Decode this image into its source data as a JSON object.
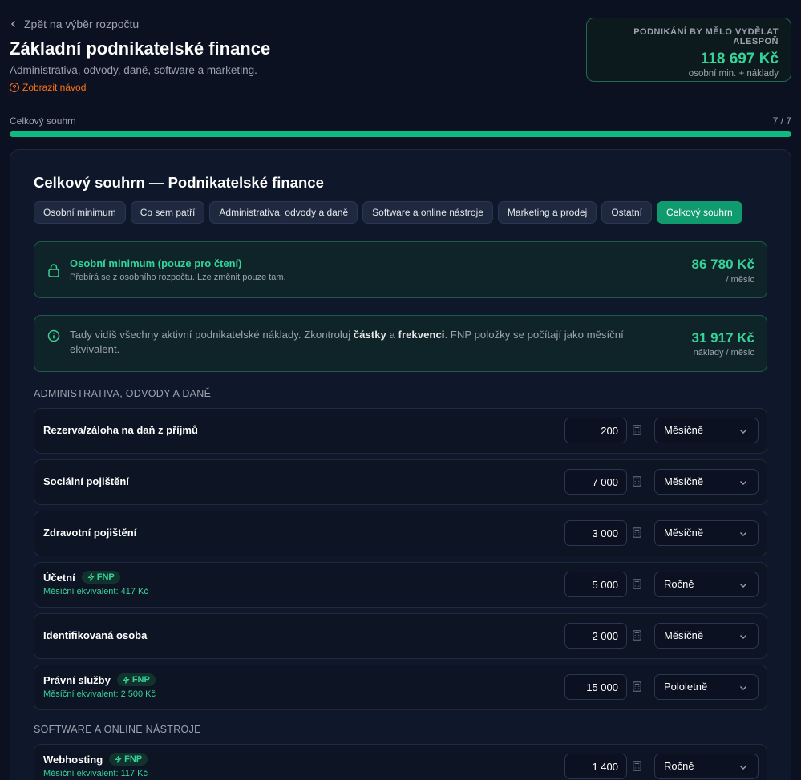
{
  "header": {
    "back_label": "Zpět na výběr rozpočtu",
    "title": "Základní podnikatelské finance",
    "subtitle": "Administrativa, odvody, daně, software a marketing.",
    "guide_label": "Zobrazit návod"
  },
  "earn_card": {
    "label": "PODNIKÁNÍ BY MĚLO VYDĚLAT ALESPOŇ",
    "value": "118 697 Kč",
    "sub": "osobní min. + náklady"
  },
  "progress": {
    "label": "Celkový souhrn",
    "count": "7 / 7",
    "fraction": 1.0
  },
  "section": {
    "title": "Celkový souhrn — Podnikatelské finance"
  },
  "tabs": [
    {
      "label": "Osobní minimum",
      "active": false
    },
    {
      "label": "Co sem patří",
      "active": false
    },
    {
      "label": "Administrativa, odvody a daně",
      "active": false
    },
    {
      "label": "Software a online nástroje",
      "active": false
    },
    {
      "label": "Marketing a prodej",
      "active": false
    },
    {
      "label": "Ostatní",
      "active": false
    },
    {
      "label": "Celkový souhrn",
      "active": true
    }
  ],
  "personal_min": {
    "title": "Osobní minimum (pouze pro čtení)",
    "desc": "Přebírá se z osobního rozpočtu. Lze změnit pouze tam.",
    "amount": "86 780 Kč",
    "unit": "/ měsíc"
  },
  "summary": {
    "text_1": "Tady vidíš všechny aktivní podnikatelské náklady. Zkontroluj ",
    "bold_1": "částky",
    "text_2": " a ",
    "bold_2": "frekvenci",
    "text_3": ". FNP položky se počítají jako měsíční ekvivalent.",
    "amount": "31 917 Kč",
    "unit": "náklady / měsíc"
  },
  "groups": [
    {
      "heading": "ADMINISTRATIVA, ODVODY A DANĚ",
      "rows": [
        {
          "name": "Rezerva/záloha na daň z příjmů",
          "amount": "200",
          "frequency": "Měsíčně",
          "fnp": "",
          "equiv": ""
        },
        {
          "name": "Sociální pojištění",
          "amount": "7 000",
          "frequency": "Měsíčně",
          "fnp": "",
          "equiv": ""
        },
        {
          "name": "Zdravotní pojištění",
          "amount": "3 000",
          "frequency": "Měsíčně",
          "fnp": "",
          "equiv": ""
        },
        {
          "name": "Účetní",
          "amount": "5 000",
          "frequency": "Ročně",
          "fnp": "FNP",
          "equiv": "Měsíční ekvivalent: 417 Kč"
        },
        {
          "name": "Identifikovaná osoba",
          "amount": "2 000",
          "frequency": "Měsíčně",
          "fnp": "",
          "equiv": ""
        },
        {
          "name": "Právní služby",
          "amount": "15 000",
          "frequency": "Pololetně",
          "fnp": "FNP",
          "equiv": "Měsíční ekvivalent: 2 500 Kč"
        }
      ]
    },
    {
      "heading": "SOFTWARE A ONLINE NÁSTROJE",
      "rows": [
        {
          "name": "Webhosting",
          "amount": "1 400",
          "frequency": "Ročně",
          "fnp": "FNP",
          "equiv": "Měsíční ekvivalent: 117 Kč"
        }
      ]
    }
  ],
  "colors": {
    "accent": "#10b981",
    "accent_text": "#34d399",
    "background": "#0b1120",
    "link_orange": "#f97316"
  },
  "icons": [
    "chevron-left-icon",
    "question-circle-icon",
    "lock-icon",
    "info-circle-icon",
    "calculator-icon",
    "chevron-down-icon",
    "bolt-icon"
  ]
}
